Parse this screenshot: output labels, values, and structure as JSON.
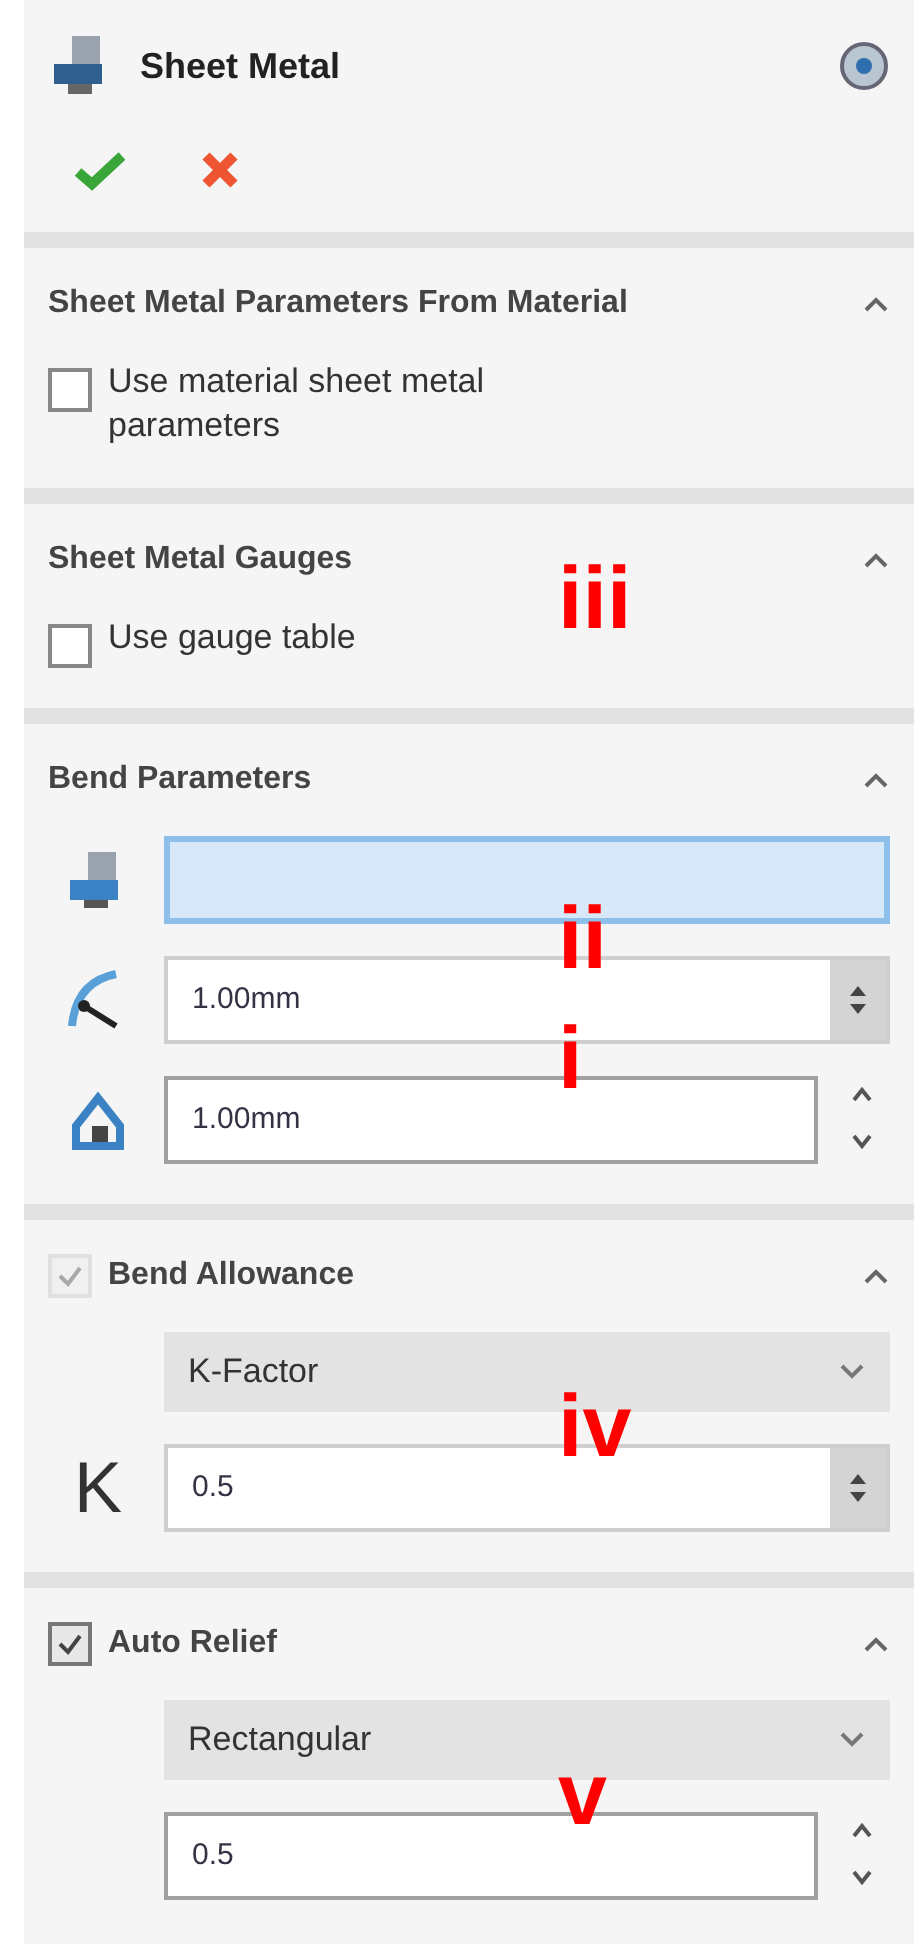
{
  "title": "Sheet Metal",
  "sections": [
    {
      "title": "Sheet Metal Parameters From Material",
      "controls": [
        {
          "kind": "checkbox",
          "label": "Use material sheet metal parameters",
          "checked": false
        }
      ]
    },
    {
      "title": "Sheet Metal Gauges",
      "controls": [
        {
          "kind": "checkbox",
          "label": "Use gauge table",
          "checked": false,
          "annotation": "iii"
        }
      ]
    },
    {
      "title": "Bend Parameters",
      "controls": [
        {
          "kind": "selection"
        },
        {
          "kind": "spin",
          "value": "1.00mm",
          "boxed": true,
          "annotation": "ii"
        },
        {
          "kind": "spin",
          "value": "1.00mm",
          "boxed": false,
          "annotation": "i"
        }
      ]
    },
    {
      "title": "Bend Allowance",
      "header_checkbox": {
        "checked": true,
        "disabled": true
      },
      "controls": [
        {
          "kind": "dropdown",
          "value": "K-Factor"
        },
        {
          "kind": "spin",
          "label": "K",
          "value": "0.5",
          "boxed": true,
          "annotation": "iv"
        }
      ]
    },
    {
      "title": "Auto Relief",
      "header_checkbox": {
        "checked": true,
        "disabled": false
      },
      "controls": [
        {
          "kind": "dropdown",
          "value": "Rectangular"
        },
        {
          "kind": "spin",
          "value": "0.5",
          "boxed": false,
          "annotation": "v"
        }
      ]
    }
  ]
}
